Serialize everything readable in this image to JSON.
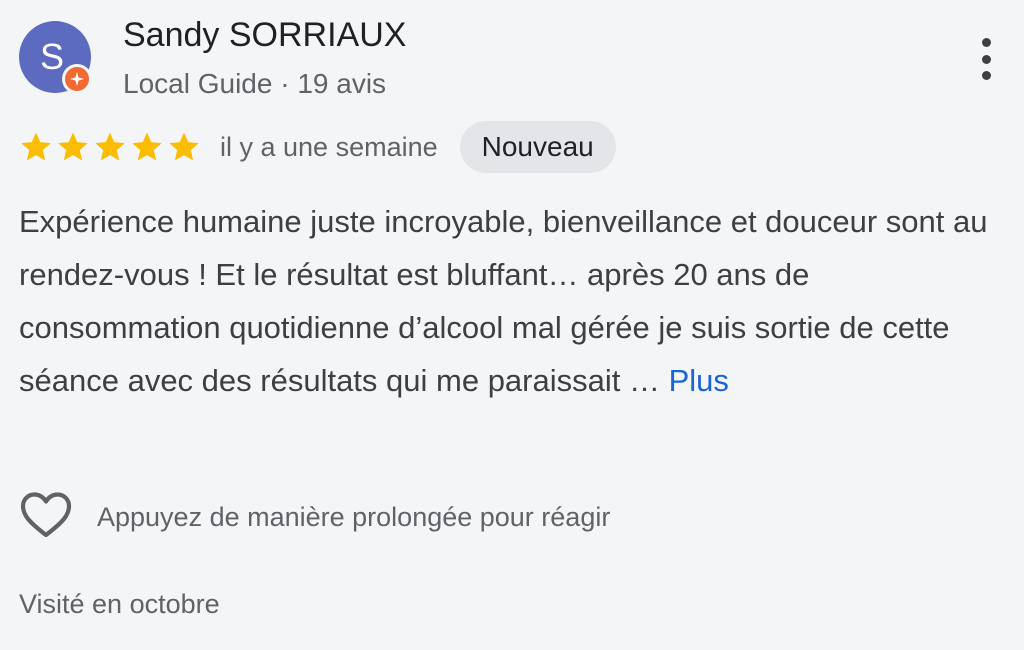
{
  "reviewer": {
    "avatar_letter": "S",
    "avatar_color": "#5c6bc0",
    "badge_icon": "local-guide-star-badge",
    "badge_color": "#f06b34",
    "name": "Sandy SORRIAUX",
    "meta": "Local Guide · 19 avis"
  },
  "menu": {
    "icon": "more-vertical-icon"
  },
  "rating": {
    "stars": 5,
    "max": 5,
    "star_color": "#fbbc04",
    "time": "il y a une semaine",
    "badge": "Nouveau"
  },
  "review": {
    "text": "Expérience humaine juste incroyable, bienveillance et douceur sont au rendez-vous ! Et le résultat est bluffant… après 20 ans de consommation quotidienne d’alcool mal gérée je suis sortie de cette séance avec des résultats qui me paraissait …",
    "more_label": "Plus",
    "link_color": "#1a64d6"
  },
  "reaction": {
    "icon": "heart-outline-icon",
    "hint": "Appuyez de manière prolongée pour réagir"
  },
  "visit": {
    "label": "Visité en octobre"
  }
}
